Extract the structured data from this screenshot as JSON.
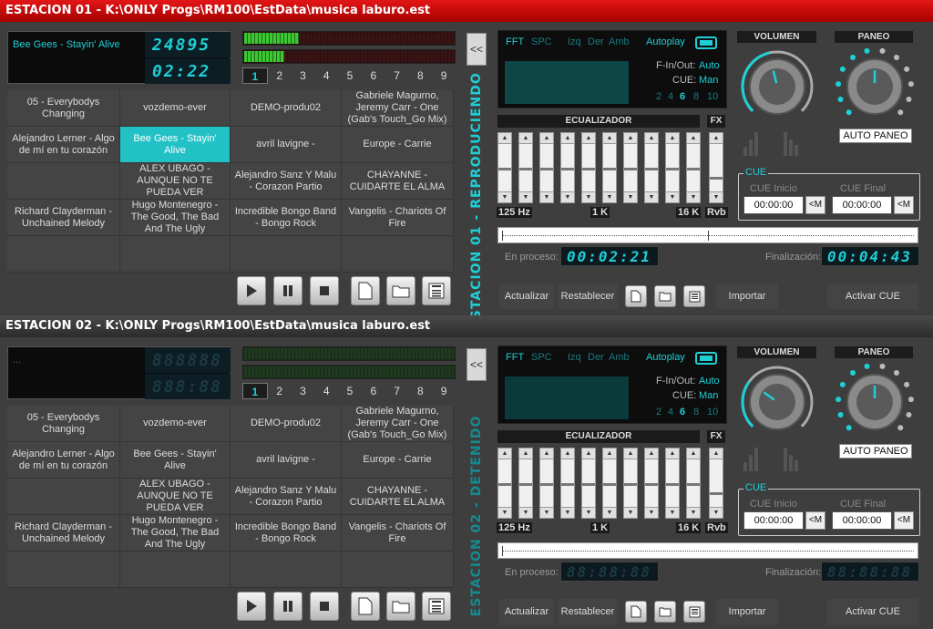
{
  "stations": [
    {
      "title": "ESTACION 01 - K:\\ONLY Progs\\RM100\\EstData\\musica laburo.est",
      "now_playing": "Bee Gees - Stayin' Alive",
      "counter_top": "24895",
      "counter_bottom": "02:22",
      "vu_levels": [
        0.26,
        0.19
      ],
      "pages": [
        "1",
        "2",
        "3",
        "4",
        "5",
        "6",
        "7",
        "8",
        "9"
      ],
      "selected_page": "1",
      "grid": [
        "05 - Everybodys Changing",
        "vozdemo-ever",
        "DEMO-produ02",
        "Gabriele Magurno, Jeremy Carr - One (Gab's Touch_Go Mix)",
        "Alejandro Lerner - Algo de mí en tu corazón",
        "Bee Gees - Stayin' Alive",
        "avril lavigne -",
        "Europe - Carrie",
        "",
        "ALEX UBAGO - AUNQUE NO TE PUEDA VER",
        "Alejandro Sanz Y Malu - Corazon Partio",
        "CHAYANNE - CUIDARTE EL ALMA",
        "Richard Clayderman - Unchained Melody",
        "Hugo Montenegro - The Good, The Bad And The Ugly",
        "Incredible Bongo Band - Bongo Rock",
        "Vangelis - Chariots Of Fire",
        "",
        "",
        "",
        ""
      ],
      "active_cell": 5,
      "side_label": "ESTACION 01 - REPRODUCIENDO",
      "elapsed": "00:02:21",
      "remaining": "00:04:43",
      "vol_level": 0.45,
      "pan_level": 0.5
    },
    {
      "title": "ESTACION 02 - K:\\ONLY Progs\\RM100\\EstData\\musica laburo.est",
      "now_playing": "...",
      "counter_top": "888888",
      "counter_bottom": "888:88",
      "vu_levels": [
        0,
        0
      ],
      "pages": [
        "1",
        "2",
        "3",
        "4",
        "5",
        "6",
        "7",
        "8",
        "9"
      ],
      "selected_page": "1",
      "grid": [
        "05 - Everybodys Changing",
        "vozdemo-ever",
        "DEMO-produ02",
        "Gabriele Magurno, Jeremy Carr - One (Gab's Touch_Go Mix)",
        "Alejandro Lerner - Algo de mí en tu corazón",
        "Bee Gees - Stayin' Alive",
        "avril lavigne -",
        "Europe - Carrie",
        "",
        "ALEX UBAGO - AUNQUE NO TE PUEDA VER",
        "Alejandro Sanz Y Malu - Corazon Partio",
        "CHAYANNE - CUIDARTE EL ALMA",
        "Richard Clayderman - Unchained Melody",
        "Hugo Montenegro - The Good, The Bad And The Ugly",
        "Incredible Bongo Band - Bongo Rock",
        "Vangelis - Chariots Of Fire",
        "",
        "",
        "",
        ""
      ],
      "active_cell": -1,
      "side_label": "ESTACION 02 - DETENIDO",
      "elapsed": "88:88:88",
      "remaining": "88:88:88",
      "vol_level": 0.3,
      "pan_level": 0.5
    }
  ],
  "labels": {
    "collapse": "<<",
    "fft": "FFT",
    "spc": "SPC",
    "izq": "Izq",
    "der": "Der",
    "amb": "Amb",
    "autoplay": "Autoplay",
    "fin_out": "F-In/Out:",
    "auto": "Auto",
    "cue": "CUE:",
    "man": "Man",
    "rates": [
      "2",
      "4",
      "6",
      "8",
      "10"
    ],
    "ecualizador": "ECUALIZADOR",
    "fx": "FX",
    "hz125": "125 Hz",
    "k1": "1 K",
    "k16": "16 K",
    "rvb": "Rvb",
    "en_proceso": "En proceso:",
    "finalizacion": "Finalización:",
    "actualizar": "Actualizar",
    "restablecer": "Restablecer",
    "importar": "Importar",
    "activar_cue": "Activar CUE",
    "volumen": "VOLUMEN",
    "paneo": "PANEO",
    "auto_paneo": "AUTO PANEO",
    "cue_title": "CUE",
    "cue_inicio": "CUE Inicio",
    "cue_final": "CUE Final",
    "cue_time": "00:00:00",
    "cue_m": "<M"
  },
  "colors": {
    "accent": "#1ecfd6",
    "title_active": "#d80000",
    "active_cell": "#22c1c6"
  }
}
